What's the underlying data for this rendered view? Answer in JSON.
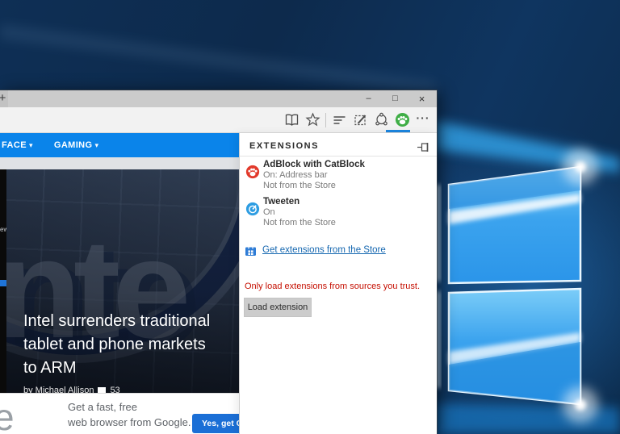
{
  "desktop": {
    "wallpaper": "windows-10-hero",
    "colors": {
      "base_navy": "#0d2a4c",
      "pane_blue": "#38a2ee",
      "pane_edge_glow": "#eaf7ff"
    }
  },
  "browser": {
    "titlebar": {
      "new_tab": "+",
      "minimize": "–",
      "maximize": "□",
      "close": "×"
    },
    "toolbar": {
      "icons": [
        "reading-view",
        "favorites-star",
        "hub",
        "web-note",
        "share",
        "adblock-paw",
        "more"
      ],
      "more_label": "···",
      "active_underline_color": "#1c86e0",
      "paw_green": "#3fae46"
    },
    "page": {
      "nav": {
        "background": "#0a84ea",
        "items": [
          {
            "label": "FACE",
            "caret": "▾"
          },
          {
            "label": "GAMING",
            "caret": "▾"
          }
        ]
      },
      "hero": {
        "bg_text": "nte",
        "side_fragment": "ew",
        "title_lines": [
          "Intel surrenders traditional",
          "tablet and phone markets",
          "to ARM"
        ],
        "byline": "by Michael Allison",
        "comments": "53"
      },
      "banner": {
        "big_letter": "e",
        "line1": "Get a fast, free",
        "line2": "web browser from Google.",
        "button_label": "Yes, get C",
        "button_color": "#1b6fd6"
      }
    },
    "panel": {
      "title": "EXTENSIONS",
      "items": [
        {
          "name": "AdBlock with CatBlock",
          "status": "On: Address bar",
          "source": "Not from the Store",
          "icon_color": "#e2392b"
        },
        {
          "name": "Tweeten",
          "status": "On",
          "source": "Not from the Store",
          "icon_color": "#2e9de2"
        }
      ],
      "store_link": "Get extensions from the Store",
      "store_icon_color": "#2e7cd6",
      "warning": "Only load extensions from sources you trust.",
      "load_button": "Load extension",
      "link_color": "#1567b0",
      "warning_color": "#c50e00"
    }
  }
}
